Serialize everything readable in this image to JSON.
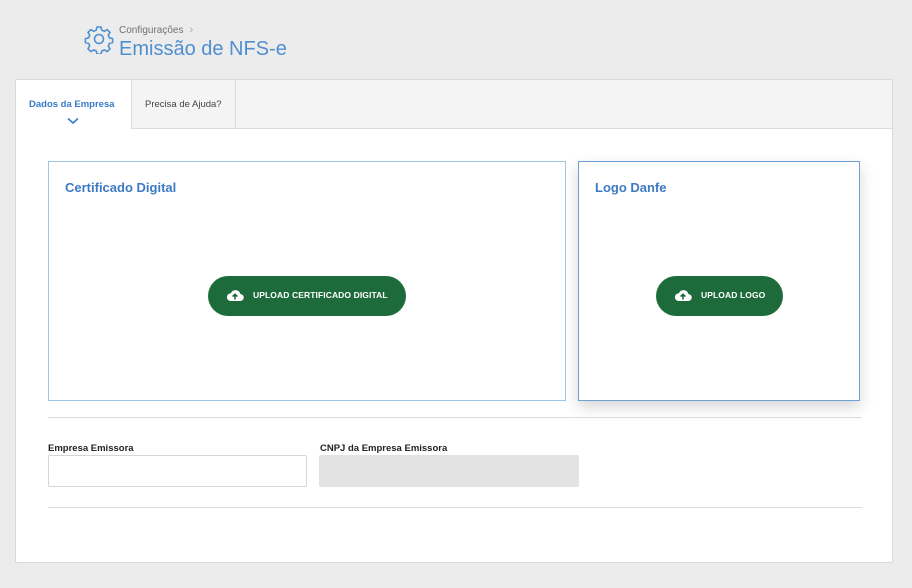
{
  "breadcrumb": {
    "parent": "Configurações",
    "separator": "›"
  },
  "page": {
    "title": "Emissão de NFS-e"
  },
  "tabs": [
    {
      "label": "Dados da Empresa",
      "active": true
    },
    {
      "label": "Precisa de Ajuda?",
      "active": false
    }
  ],
  "panels": {
    "certificate": {
      "title": "Certificado Digital",
      "button_label": "UPLOAD CERTIFICADO DIGITAL",
      "button_icon": "cloud-upload-icon"
    },
    "logo": {
      "title": "Logo Danfe",
      "button_label": "UPLOAD LOGO",
      "button_icon": "cloud-upload-icon"
    }
  },
  "form": {
    "issuer_company": {
      "label": "Empresa Emissora",
      "value": "",
      "placeholder": ""
    },
    "issuer_cnpj": {
      "label": "CNPJ da Empresa Emissora",
      "value": "",
      "placeholder": "",
      "disabled": true
    }
  },
  "colors": {
    "accent": "#3d7ac5",
    "title": "#4f8fd0",
    "button": "#1d6b3a",
    "background": "#ececec"
  }
}
